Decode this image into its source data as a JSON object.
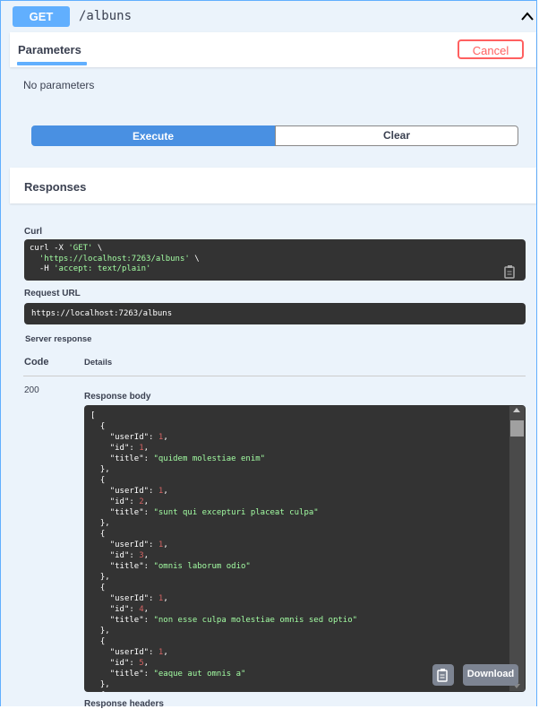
{
  "operation": {
    "method": "GET",
    "path": "/albuns"
  },
  "parameters": {
    "tab_label": "Parameters",
    "cancel_label": "Cancel",
    "empty_text": "No parameters"
  },
  "actions": {
    "execute_label": "Execute",
    "clear_label": "Clear"
  },
  "responses": {
    "title": "Responses",
    "curl_label": "Curl",
    "curl": {
      "line1_cmd": "curl -X ",
      "line1_method": "'GET'",
      "line1_end": " \\",
      "line2_url": "'https://localhost:7263/albuns'",
      "line2_end": " \\",
      "line3_flag": "  -H ",
      "line3_header": "'accept: text/plain'"
    },
    "request_url_label": "Request URL",
    "request_url": "https://localhost:7263/albuns",
    "server_response_label": "Server response",
    "code_header": "Code",
    "details_header": "Details",
    "status_code": "200",
    "response_body_label": "Response body",
    "response_headers_label": "Response headers",
    "download_label": "Download",
    "body_items": [
      {
        "userId": "1",
        "id": "1",
        "title": "\"quidem molestiae enim\""
      },
      {
        "userId": "1",
        "id": "2",
        "title": "\"sunt qui excepturi placeat culpa\""
      },
      {
        "userId": "1",
        "id": "3",
        "title": "\"omnis laborum odio\""
      },
      {
        "userId": "1",
        "id": "4",
        "title": "\"non esse culpa molestiae omnis sed optio\""
      },
      {
        "userId": "1",
        "id": "5",
        "title": "\"eaque aut omnis a\""
      }
    ]
  },
  "colors": {
    "get_blue": "#61affe",
    "execute_blue": "#4990e2",
    "cancel_red": "#ff6060",
    "code_bg": "#333333",
    "string_green": "#a2fca2",
    "number_red": "#d36363"
  },
  "icons": [
    "chevron-up-icon",
    "copy-icon",
    "clipboard-icon"
  ]
}
